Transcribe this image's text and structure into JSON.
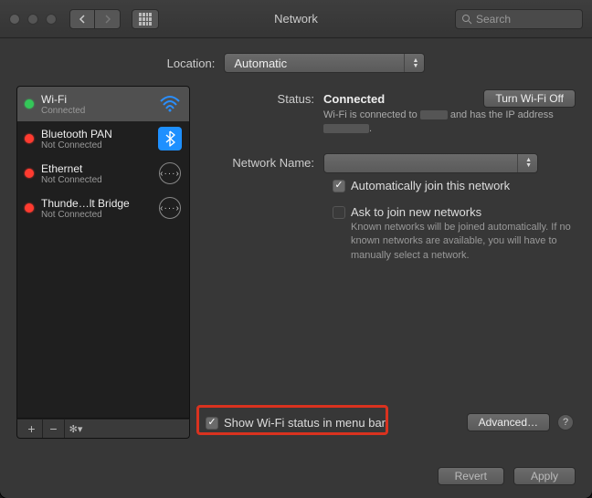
{
  "titlebar": {
    "title": "Network",
    "search_placeholder": "Search"
  },
  "location": {
    "label": "Location:",
    "value": "Automatic"
  },
  "sidebar": {
    "items": [
      {
        "name": "Wi-Fi",
        "status": "Connected"
      },
      {
        "name": "Bluetooth PAN",
        "status": "Not Connected"
      },
      {
        "name": "Ethernet",
        "status": "Not Connected"
      },
      {
        "name": "Thunde…lt Bridge",
        "status": "Not Connected"
      }
    ],
    "tools": {
      "add": "+",
      "remove": "−",
      "gear": "✻▾"
    }
  },
  "detail": {
    "status_label": "Status:",
    "status_value": "Connected",
    "turn_off": "Turn Wi-Fi Off",
    "status_desc_prefix": "Wi-Fi is connected to ",
    "status_desc_mid": " and has the IP address ",
    "status_desc_suffix": ".",
    "netname_label": "Network Name:",
    "netname_value": "",
    "auto_join": "Automatically join this network",
    "ask_join": "Ask to join new networks",
    "ask_desc": "Known networks will be joined automatically. If no known networks are available, you will have to manually select a network."
  },
  "bottom": {
    "show_status": "Show Wi-Fi status in menu bar",
    "advanced": "Advanced…",
    "help": "?"
  },
  "footer": {
    "revert": "Revert",
    "apply": "Apply"
  }
}
